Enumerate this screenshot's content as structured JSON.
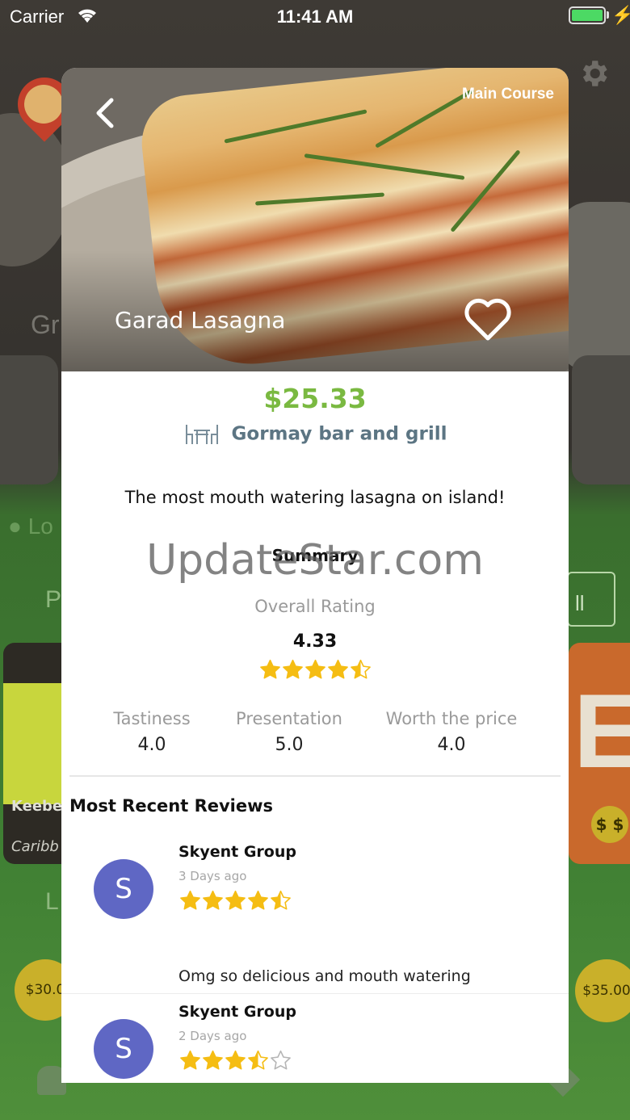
{
  "status_bar": {
    "carrier": "Carrier",
    "time": "11:41 AM"
  },
  "background": {
    "partial_heading_1": "Gr",
    "partial_location": "Lo",
    "partial_heading_2": "P",
    "partial_view_all": "ll",
    "promo_left_title": "Keebee",
    "promo_left_sub": "Caribb",
    "promo_right_big": "E",
    "promo_right_coin": "$ $",
    "partial_heading_3": "L",
    "coin_left": "$30.0",
    "coin_right": "$35.00"
  },
  "dish": {
    "category": "Main Course",
    "name": "Garad Lasagna",
    "price": "$25.33",
    "restaurant": "Gormay bar and grill",
    "description": "The most mouth watering lasagna on island!"
  },
  "watermark": "UpdateStar.com",
  "summary": {
    "heading": "Summary",
    "overall_label": "Overall Rating",
    "overall_value": "4.33",
    "overall_stars": 4.5,
    "metrics": [
      {
        "label": "Tastiness",
        "value": "4.0"
      },
      {
        "label": "Presentation",
        "value": "5.0"
      },
      {
        "label": "Worth the price",
        "value": "4.0"
      }
    ]
  },
  "reviews": {
    "heading": "Most Recent Reviews",
    "items": [
      {
        "initial": "S",
        "name": "Skyent Group",
        "date": "3 Days ago",
        "stars": 4.5,
        "text": "Omg so delicious and mouth watering"
      },
      {
        "initial": "S",
        "name": "Skyent Group",
        "date": "2 Days ago",
        "stars": 3.5,
        "text": ""
      }
    ]
  },
  "colors": {
    "accent_green": "#7ab941",
    "star": "#f5bd13",
    "avatar": "#5f67c4",
    "restaurant": "#5c7583"
  }
}
